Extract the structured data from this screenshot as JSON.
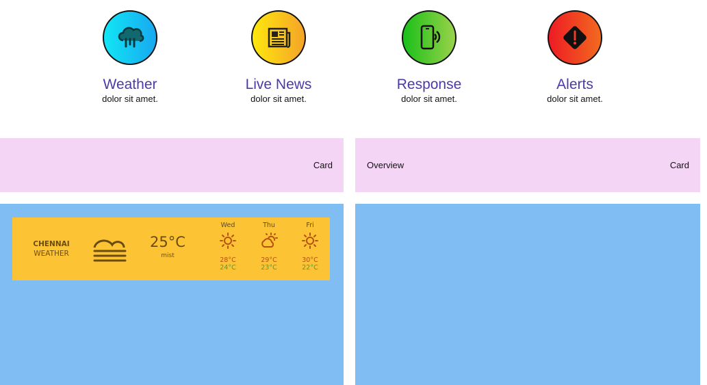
{
  "features": [
    {
      "title": "Weather",
      "subtitle": "dolor sit amet.",
      "icon": "cloud-rain-icon"
    },
    {
      "title": "Live News",
      "subtitle": "dolor sit amet.",
      "icon": "newspaper-icon"
    },
    {
      "title": "Response",
      "subtitle": "dolor sit amet.",
      "icon": "phone-signal-icon"
    },
    {
      "title": "Alerts",
      "subtitle": "dolor sit amet.",
      "icon": "warning-diamond-icon"
    }
  ],
  "bars": {
    "left": {
      "right_label": "Card"
    },
    "right": {
      "left_label": "Overview",
      "right_label": "Card"
    }
  },
  "weather": {
    "city": "CHENNAI",
    "label": "WEATHER",
    "temp": "25°C",
    "desc": "mist",
    "icon": "mist-icon",
    "forecast": [
      {
        "day": "Wed",
        "icon": "sun-icon",
        "high": "28°C",
        "low": "24°C"
      },
      {
        "day": "Thu",
        "icon": "partly-cloudy-icon",
        "high": "29°C",
        "low": "23°C"
      },
      {
        "day": "Fri",
        "icon": "sun-icon",
        "high": "30°C",
        "low": "22°C"
      }
    ]
  },
  "colors": {
    "title": "#4a3aa8",
    "bar": "#f5d5f6",
    "panel": "#80bdf3",
    "weather_card": "#fcc434"
  }
}
